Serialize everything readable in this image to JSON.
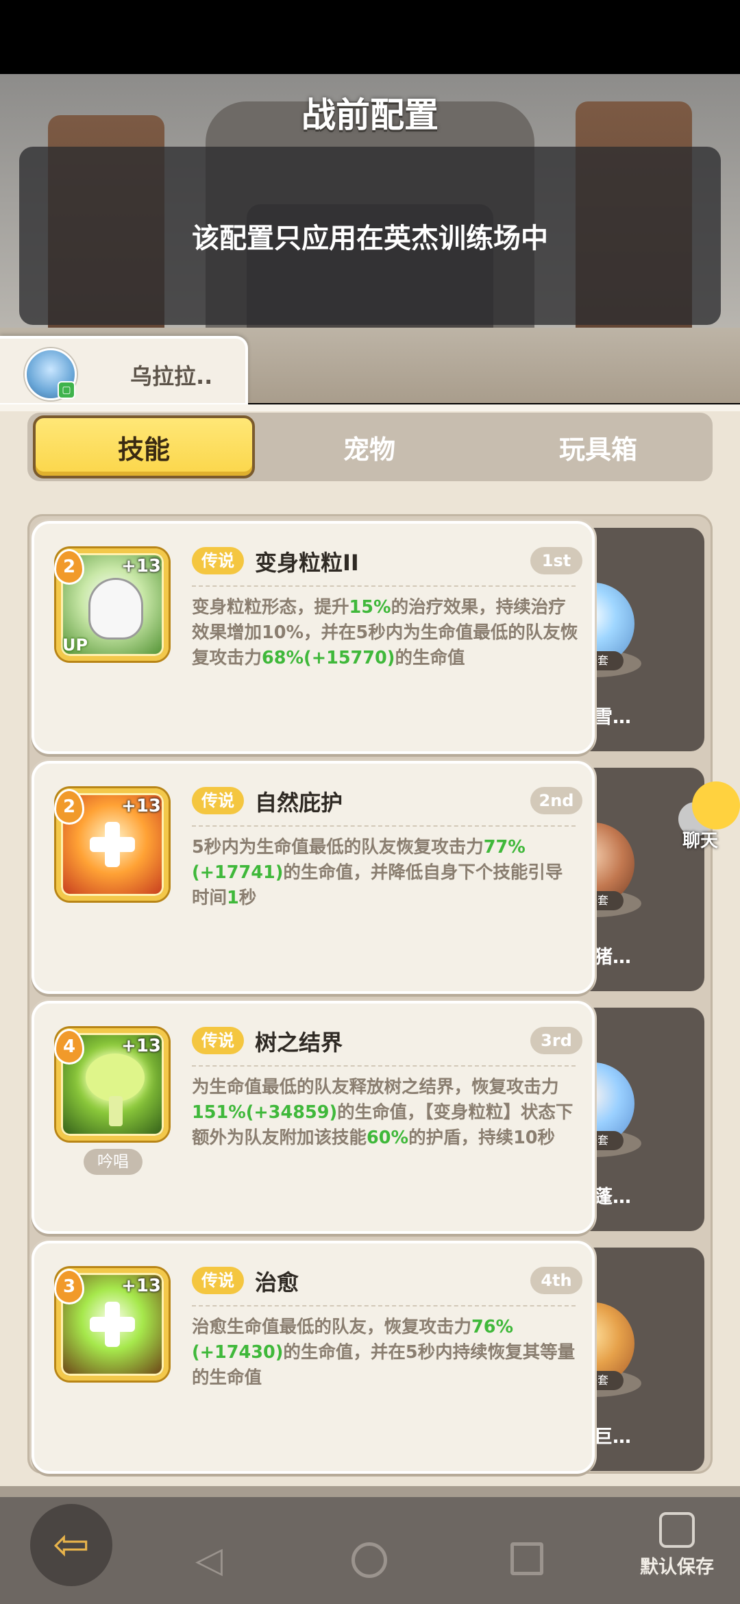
{
  "header": {
    "title": "战前配置",
    "notice": "该配置只应用在英杰训练场中"
  },
  "hero": {
    "name": "乌拉拉.."
  },
  "tabs": [
    {
      "label": "技能",
      "active": true
    },
    {
      "label": "宠物",
      "active": false
    },
    {
      "label": "玩具箱",
      "active": false
    }
  ],
  "skills": [
    {
      "level": "2",
      "plus": "+13",
      "up": "UP",
      "rarity": "传说",
      "name": "变身粒粒II",
      "order": "1st",
      "desc_parts": [
        "变身粒粒形态，提升",
        "15%",
        "的治疗效果，持续治疗效果增加10%，并在5秒内为生命值最低的队友恢复攻击力",
        "68%(+15770)",
        "的生命值"
      ],
      "pet": {
        "name": "快乐的雪…",
        "tag": "六件套"
      }
    },
    {
      "level": "2",
      "plus": "+13",
      "rarity": "传说",
      "name": "自然庇护",
      "order": "2nd",
      "desc_parts": [
        "5秒内为生命值最低的队友恢复攻击力",
        "77%(+17741)",
        "的生命值，并降低自身下个技能引导时间",
        "1",
        "秒"
      ],
      "pet": {
        "name": "活跃的猪…",
        "tag": "六件套"
      }
    },
    {
      "level": "4",
      "plus": "+13",
      "chant": "吟唱",
      "rarity": "传说",
      "name": "树之结界",
      "order": "3rd",
      "desc_parts": [
        "为生命值最低的队友释放树之结界，恢复攻击力",
        "151%(+34859)",
        "的生命值，【变身粒粒】状态下额外为队友附加该技能",
        "60%",
        "的护盾，持续10秒"
      ],
      "pet": {
        "name": "发呆的蓬…",
        "tag": "六件套"
      }
    },
    {
      "level": "3",
      "plus": "+13",
      "rarity": "传说",
      "name": "治愈",
      "order": "4th",
      "desc_parts": [
        "治愈生命值最低的队友，恢复攻击力",
        "76%(+17430)",
        "的生命值，并在5秒内持续恢复其等量的生命值",
        "",
        ""
      ],
      "pet": {
        "name": "友好的巨…",
        "tag": "六件套"
      }
    }
  ],
  "chat": {
    "label": "聊天"
  },
  "bottom": {
    "save_label": "默认保存"
  },
  "colors": {
    "accent": "#fbd64a",
    "highlight": "#3fb83a",
    "rarity": "#f4c640"
  }
}
